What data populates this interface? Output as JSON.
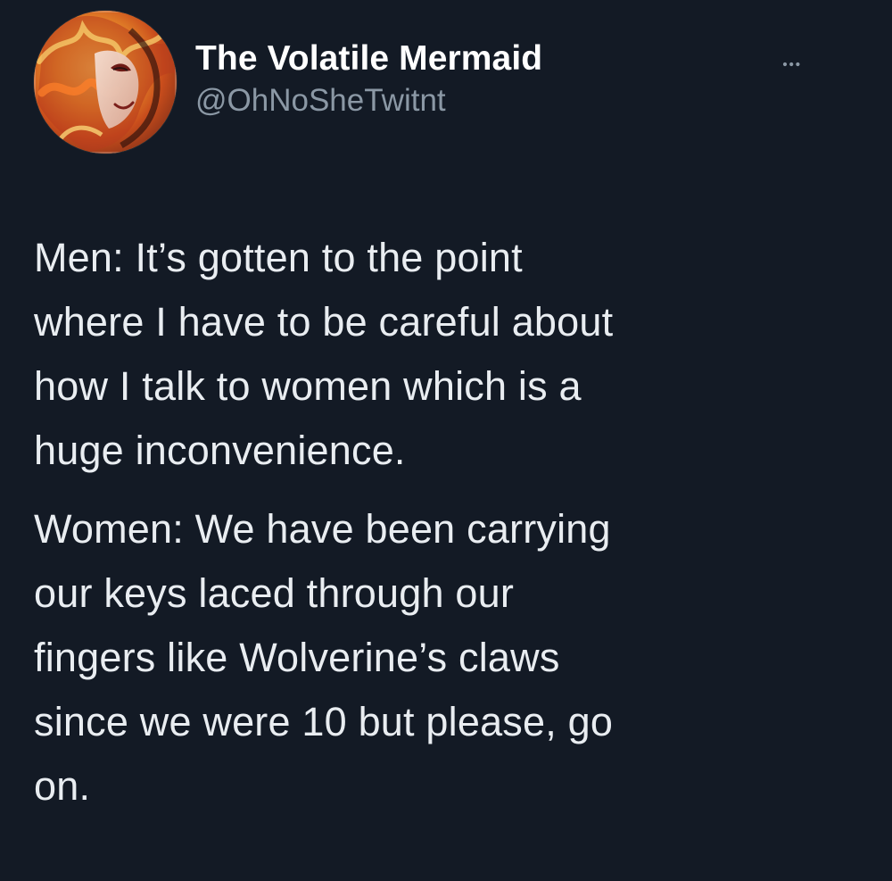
{
  "tweet": {
    "display_name": "The Volatile Mermaid",
    "handle": "@OhNoSheTwitnt",
    "more_icon": "ellipsis-horizontal",
    "avatar_icon": "profile-photo",
    "body": [
      "Men: It’s gotten to the point\nwhere I have to be careful about\nhow I talk to women which is a\nhuge inconvenience.",
      "Women: We have been carrying\nour keys laced through our\nfingers like Wolverine’s claws\nsince we were 10 but please, go\non."
    ]
  },
  "colors": {
    "background": "#131a25",
    "text": "#e9edf1",
    "secondary_text": "#8b98a5"
  }
}
